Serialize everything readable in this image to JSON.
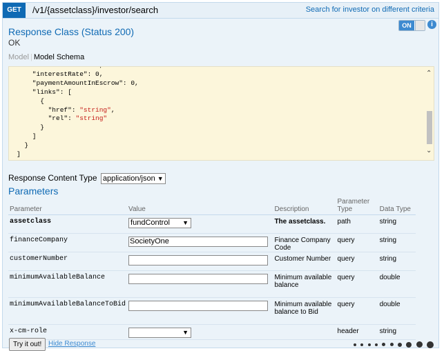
{
  "endpoint": {
    "method": "GET",
    "path": "/v1/{assetclass}/investor/search",
    "summary": "Search for investor on different criteria"
  },
  "response": {
    "class_title": "Response Class (Status 200)",
    "status_text": "OK",
    "toggle_label": "ON",
    "info_glyph": "i"
  },
  "model_tabs": {
    "model": "Model",
    "schema": "Model Schema"
  },
  "schema_lines": [
    "    \"interestRate\": 0,",
    "    \"interestRate\": 0,",
    "    \"paymentAmountInEscrow\": 0,",
    "    \"links\": [",
    "      {",
    "        \"href\": \"string\",",
    "        \"rel\": \"string\"",
    "      }",
    "    ]",
    "  }",
    "]"
  ],
  "content_type": {
    "label": "Response Content Type",
    "selected": "application/json"
  },
  "parameters": {
    "title": "Parameters",
    "headers": [
      "Parameter",
      "Value",
      "Description",
      "Parameter Type",
      "Data Type"
    ],
    "rows": [
      {
        "name": "assetclass",
        "required": true,
        "control": "select",
        "value": "fundControl",
        "description": "The assetclass.",
        "param_type": "path",
        "data_type": "string"
      },
      {
        "name": "financeCompany",
        "required": false,
        "control": "input",
        "value": "SocietyOne",
        "description": "Finance Company Code",
        "param_type": "query",
        "data_type": "string"
      },
      {
        "name": "customerNumber",
        "required": false,
        "control": "input",
        "value": "",
        "description": "Customer Number",
        "param_type": "query",
        "data_type": "string"
      },
      {
        "name": "minimumAvailableBalance",
        "required": false,
        "control": "input",
        "value": "",
        "description": "Minimum available balance",
        "param_type": "query",
        "data_type": "double"
      },
      {
        "name": "minimumAvailableBalanceToBid",
        "required": false,
        "control": "input",
        "value": "",
        "description": "Minimum available balance to Bid",
        "param_type": "query",
        "data_type": "double"
      },
      {
        "name": "x-cm-role",
        "required": false,
        "control": "select",
        "value": "",
        "description": "",
        "param_type": "header",
        "data_type": "string"
      }
    ]
  },
  "actions": {
    "try_label": "Try it out!",
    "hide_label": "Hide Response"
  }
}
